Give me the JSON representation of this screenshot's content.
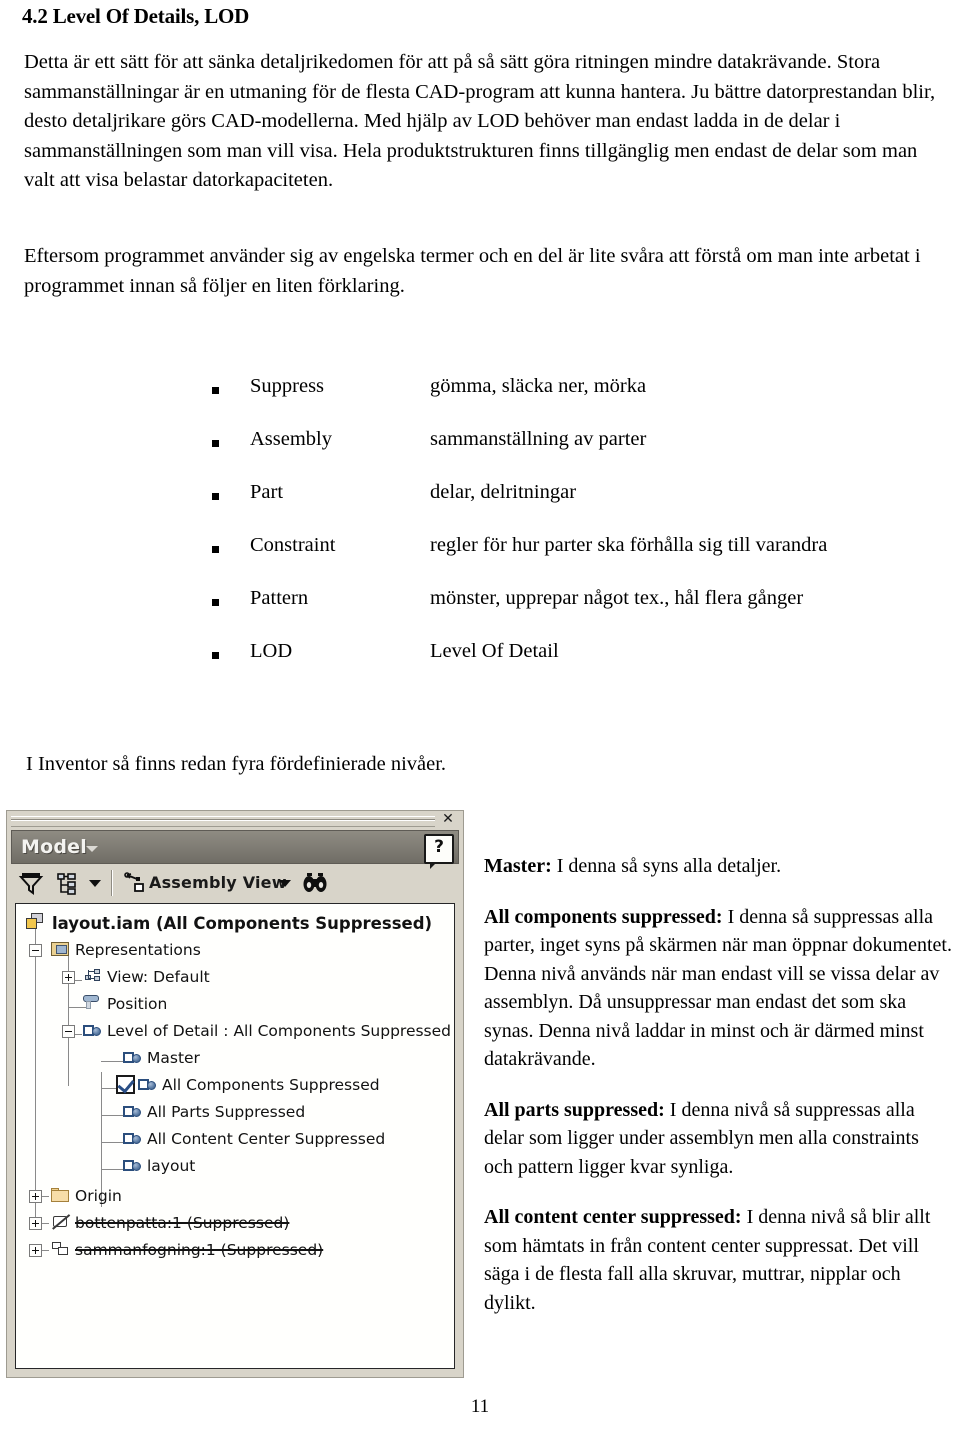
{
  "document": {
    "heading": "4.2 Level Of Details, LOD",
    "paragraph_intro": "Detta är ett sätt för att sänka detaljrikedomen för att på så sätt göra ritningen mindre datakrävande. Stora sammanställningar är en utmaning för de flesta CAD-program att kunna hantera. Ju bättre datorprestandan blir, desto detaljrikare görs CAD-modellerna. Med hjälp av LOD behöver man endast ladda in de delar i sammanställningen som man vill visa. Hela produktstrukturen finns tillgänglig men endast de delar som man valt att visa belastar datorkapaciteten.",
    "paragraph_terms": "Eftersom programmet använder sig av engelska termer och en del är lite svåra att förstå om man inte arbetat i programmet innan så följer en liten förklaring.",
    "paragraph_inventor": "I Inventor så finns redan fyra fördefinierade nivåer.",
    "page_number": "11"
  },
  "glossary": [
    {
      "term": "Suppress",
      "definition": "gömma, släcka ner, mörka"
    },
    {
      "term": "Assembly",
      "definition": "sammanställning av parter"
    },
    {
      "term": "Part",
      "definition": "delar, delritningar"
    },
    {
      "term": "Constraint",
      "definition": "regler för hur parter ska förhålla sig till varandra"
    },
    {
      "term": "Pattern",
      "definition": "mönster, upprepar något tex., hål flera gånger"
    },
    {
      "term": "LOD",
      "definition": "Level Of Detail"
    }
  ],
  "explanations": [
    {
      "label": "Master:",
      "text": " I denna så syns alla detaljer."
    },
    {
      "label": "All components suppressed:",
      "text": "  I denna så suppressas alla parter, inget syns på skärmen när man öppnar dokumentet. Denna nivå används när man endast vill se vissa delar av assemblyn. Då unsuppressar man endast det som ska synas. Denna nivå laddar in minst och är därmed minst datakrävande."
    },
    {
      "label": "All parts suppressed:",
      "text": " I denna nivå så suppressas alla delar som ligger under assemblyn men alla constraints och pattern ligger kvar synliga."
    },
    {
      "label": "All content center suppressed:",
      "text": " I denna nivå så blir allt som hämtats in från content center suppressat. Det vill säga i de flesta fall alla skruvar, muttrar, nipplar och dylikt."
    }
  ],
  "inventor_panel": {
    "close_glyph": "✕",
    "title": "Model",
    "help_glyph": "?",
    "toolbar": {
      "filter_icon": "filter-funnel-icon",
      "hierarchy_icon": "tree-hierarchy-icon",
      "view_label": "Assembly View",
      "find_icon": "binoculars-icon"
    },
    "tree": [
      {
        "label": "layout.iam (All Components Suppressed)",
        "icon": "assembly-document-icon",
        "depth": 0,
        "bold": true,
        "expander": "none",
        "strike": false,
        "checked": false
      },
      {
        "label": "Representations",
        "icon": "representations-folder-icon",
        "depth": 1,
        "bold": false,
        "expander": "minus",
        "strike": false,
        "checked": false
      },
      {
        "label": "View: Default",
        "icon": "view-representation-icon",
        "depth": 2,
        "bold": false,
        "expander": "plus",
        "strike": false,
        "checked": false
      },
      {
        "label": "Position",
        "icon": "position-representation-icon",
        "depth": 2,
        "bold": false,
        "expander": "none",
        "strike": false,
        "checked": false
      },
      {
        "label": "Level of Detail : All Components Suppressed",
        "icon": "lod-icon",
        "depth": 2,
        "bold": false,
        "expander": "minus",
        "strike": false,
        "checked": false
      },
      {
        "label": "Master",
        "icon": "lod-icon",
        "depth": 3,
        "bold": false,
        "expander": "none",
        "strike": false,
        "checked": false
      },
      {
        "label": "All Components Suppressed",
        "icon": "lod-icon",
        "depth": 3,
        "bold": false,
        "expander": "none",
        "strike": false,
        "checked": true
      },
      {
        "label": "All Parts Suppressed",
        "icon": "lod-icon",
        "depth": 3,
        "bold": false,
        "expander": "none",
        "strike": false,
        "checked": false
      },
      {
        "label": "All Content Center Suppressed",
        "icon": "lod-icon",
        "depth": 3,
        "bold": false,
        "expander": "none",
        "strike": false,
        "checked": false
      },
      {
        "label": "layout",
        "icon": "lod-icon",
        "depth": 3,
        "bold": false,
        "expander": "none",
        "strike": false,
        "checked": false
      },
      {
        "label": "Origin",
        "icon": "origin-folder-icon",
        "depth": 1,
        "bold": false,
        "expander": "plus",
        "strike": false,
        "checked": false
      },
      {
        "label": "bottenpatta:1 (Suppressed)",
        "icon": "part-suppressed-icon",
        "depth": 1,
        "bold": false,
        "expander": "plus",
        "strike": true,
        "checked": false
      },
      {
        "label": "sammanfogning:1 (Suppressed)",
        "icon": "subassembly-suppressed-icon",
        "depth": 1,
        "bold": false,
        "expander": "plus",
        "strike": true,
        "checked": false
      }
    ]
  },
  "colors": {
    "panel_face": "#d6d2c8",
    "titlebar": "#7e7b73",
    "tree_background": "#fdfdfb",
    "lod_accent": "#2d4f7c",
    "folder_gold": "#f0c64e"
  }
}
